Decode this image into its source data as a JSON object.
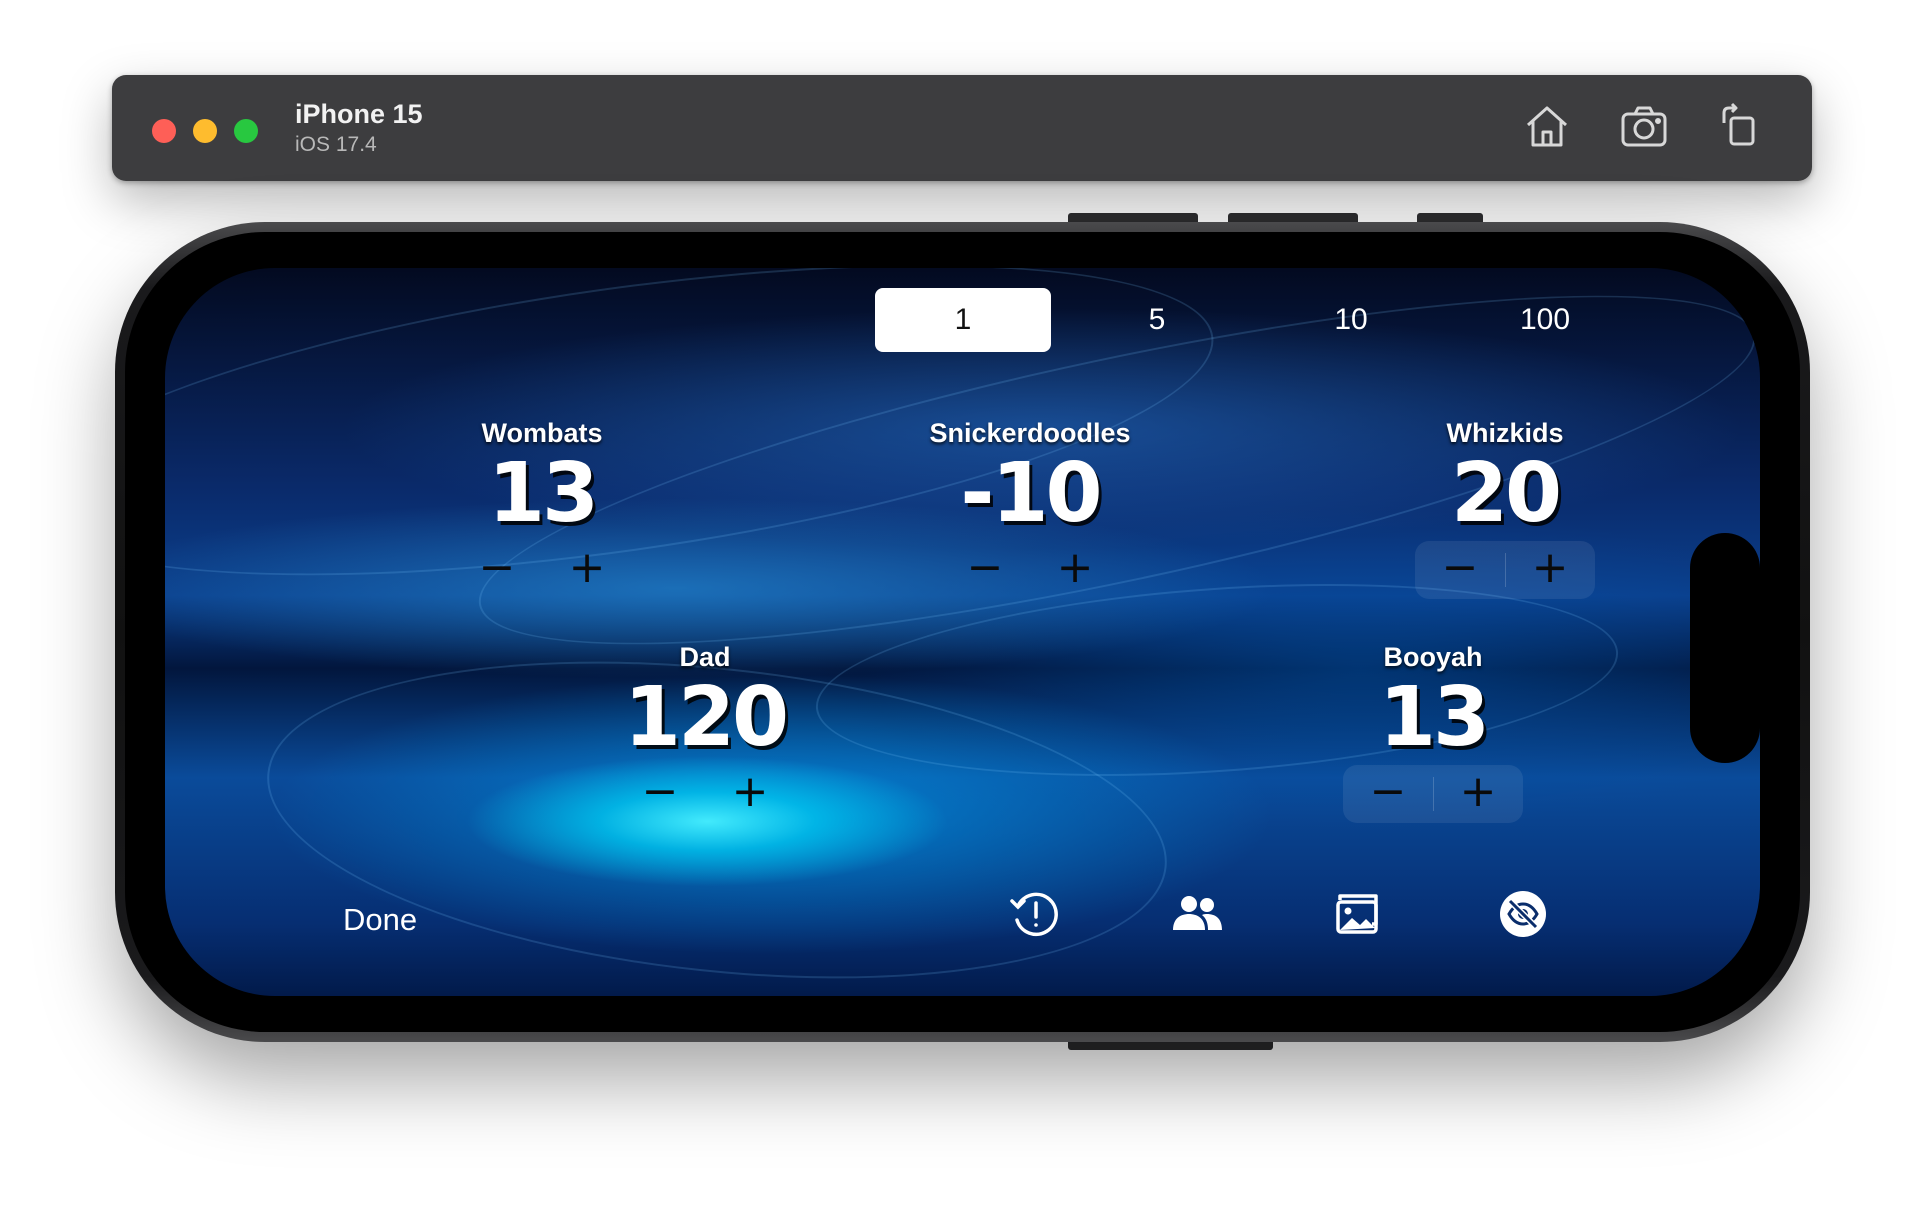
{
  "simulator": {
    "title": "iPhone 15",
    "subtitle": "iOS 17.4",
    "buttons": [
      "home-icon",
      "screenshot-icon",
      "rotate-icon"
    ]
  },
  "increments": {
    "options": [
      "1",
      "5",
      "10",
      "100"
    ],
    "selected": "1"
  },
  "teams": [
    {
      "name": "Wombats",
      "score": "13",
      "minus": "−",
      "plus": "+"
    },
    {
      "name": "Snickerdoodles",
      "score": "-10",
      "minus": "−",
      "plus": "+"
    },
    {
      "name": "Whizkids",
      "score": "20",
      "minus": "−",
      "plus": "+"
    },
    {
      "name": "Dad",
      "score": "120",
      "minus": "−",
      "plus": "+"
    },
    {
      "name": "Booyah",
      "score": "13",
      "minus": "−",
      "plus": "+"
    }
  ],
  "toolbar": {
    "done_label": "Done",
    "icons": [
      "history-alert-icon",
      "people-icon",
      "photos-icon",
      "eye-slash-icon"
    ]
  },
  "colors": {
    "accent": "#ffffff",
    "background": "#0b3f8c",
    "highlight": "#46f0ff"
  }
}
